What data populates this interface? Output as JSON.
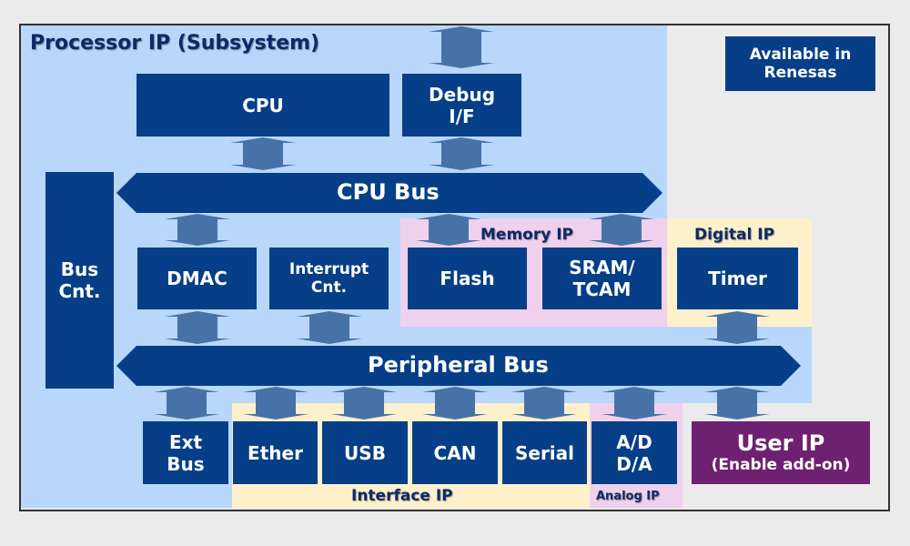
{
  "title": "Processor IP (Subsystem)",
  "legend": {
    "label": "Available in Renesas",
    "line1": "Available in",
    "line2": "Renesas"
  },
  "colors": {
    "block": "#063f87",
    "arrow": "#4672a8",
    "processor_region": "#b8d7fa",
    "memory_region": "#efd1ee",
    "digital_region": "#fdf1cc",
    "interface_region": "#fdf1cc",
    "analog_region": "#efd1ee",
    "user_ip": "#6e2170",
    "background": "#ebebeb",
    "label_text": "#0d2a66"
  },
  "regions": {
    "memory": "Memory IP",
    "digital": "Digital IP",
    "interface": "Interface IP",
    "analog": "Analog IP"
  },
  "blocks": {
    "cpu": "CPU",
    "debug_line1": "Debug",
    "debug_line2": "I/F",
    "bus_cnt_line1": "Bus",
    "bus_cnt_line2": "Cnt.",
    "dmac": "DMAC",
    "interrupt_line1": "Interrupt",
    "interrupt_line2": "Cnt.",
    "flash": "Flash",
    "sram_line1": "SRAM/",
    "sram_line2": "TCAM",
    "timer": "Timer",
    "ext_bus_line1": "Ext",
    "ext_bus_line2": "Bus",
    "ether": "Ether",
    "usb": "USB",
    "can": "CAN",
    "serial": "Serial",
    "adda_line1": "A/D",
    "adda_line2": "D/A",
    "user_ip_title": "User IP",
    "user_ip_sub": "(Enable add-on)"
  },
  "buses": {
    "cpu_bus": "CPU Bus",
    "peripheral_bus": "Peripheral Bus"
  }
}
